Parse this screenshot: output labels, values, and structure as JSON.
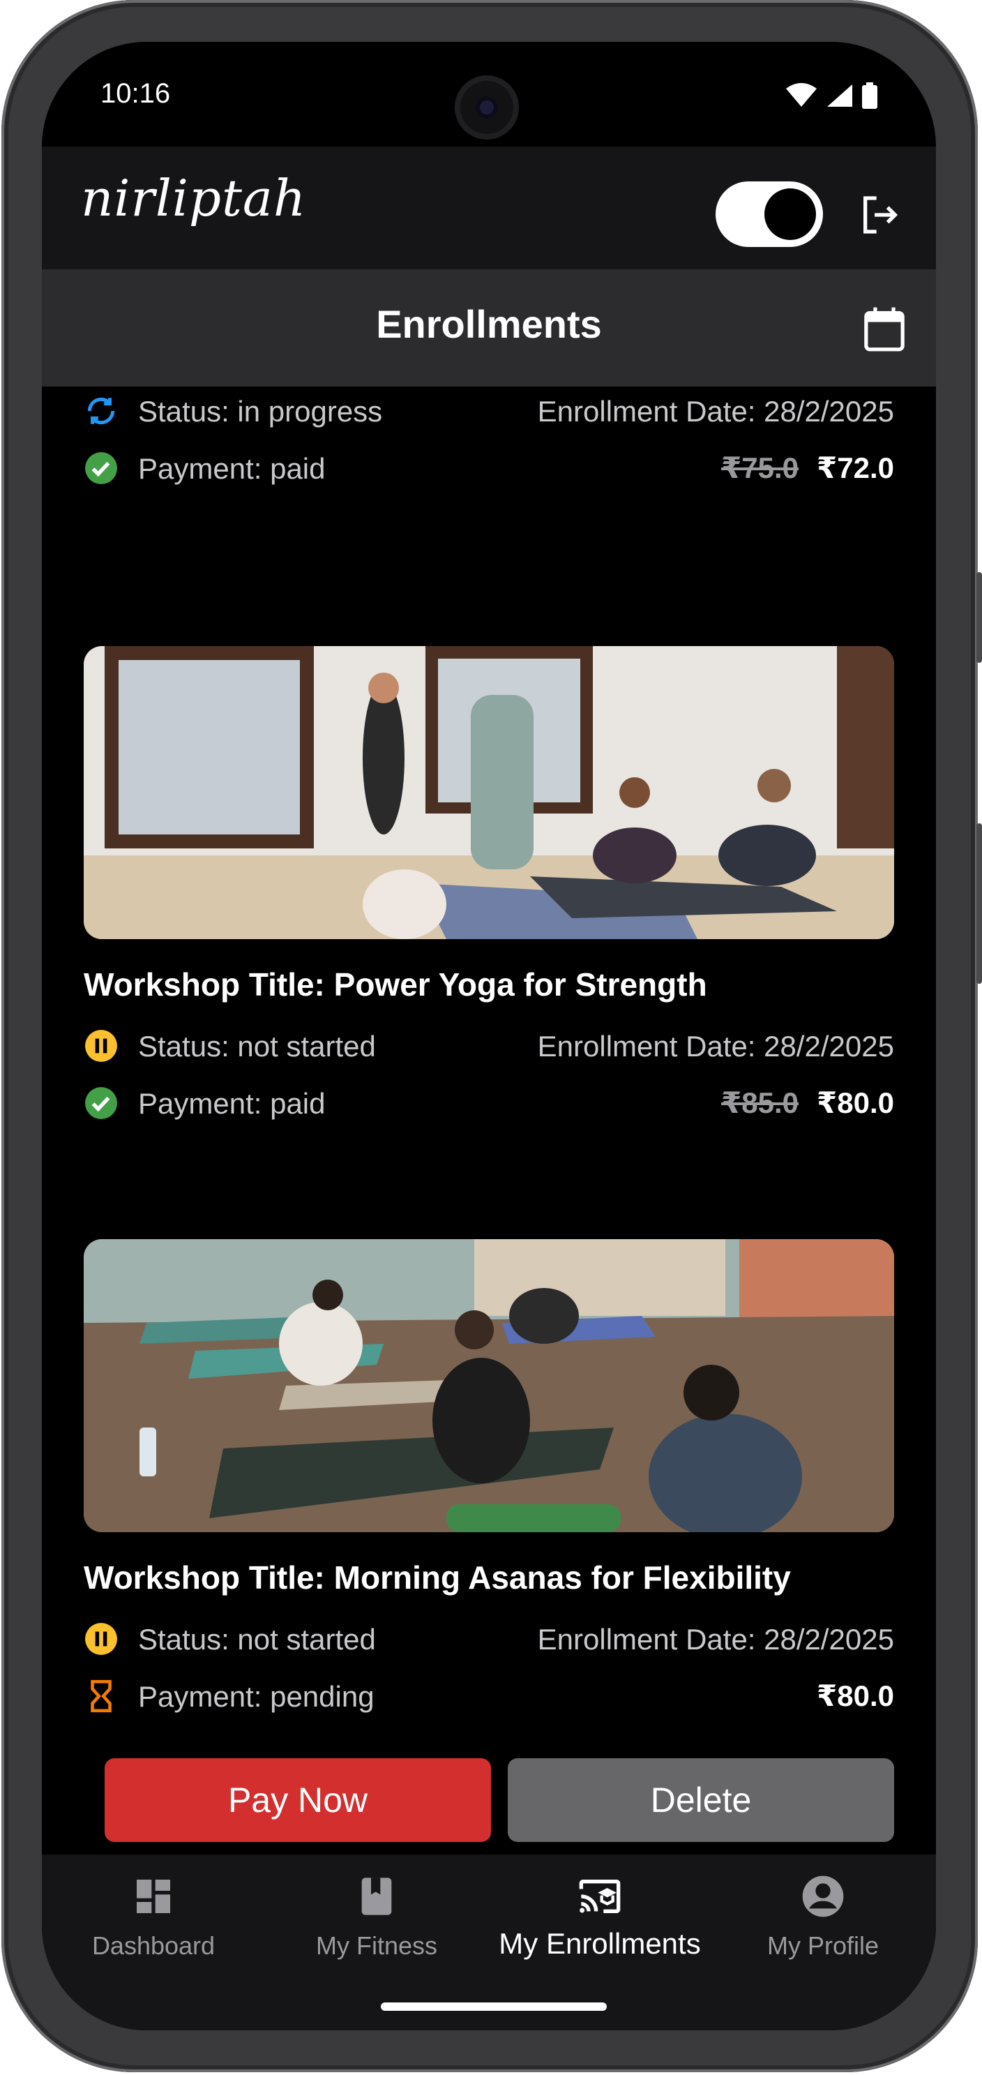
{
  "status_bar": {
    "time": "10:16"
  },
  "header": {
    "logo": "nirliptah"
  },
  "title_bar": {
    "title": "Enrollments"
  },
  "enrollments": [
    {
      "status": "Status: in progress",
      "enrollment_date": "Enrollment Date: 28/2/2025",
      "payment": "Payment: paid",
      "original_price": "₹75.0",
      "price": "₹72.0"
    },
    {
      "title": "Workshop Title: Power Yoga for Strength",
      "status": "Status: not started",
      "enrollment_date": "Enrollment Date: 28/2/2025",
      "payment": "Payment: paid",
      "original_price": "₹85.0",
      "price": "₹80.0"
    },
    {
      "title": "Workshop Title: Morning Asanas for Flexibility",
      "status": "Status: not started",
      "enrollment_date": "Enrollment Date: 28/2/2025",
      "payment": "Payment: pending",
      "price": "₹80.0",
      "pay_button": "Pay Now",
      "delete_button": "Delete"
    }
  ],
  "colors": {
    "in_progress": "#2196f3",
    "paid": "#43a047",
    "not_started": "#fbc02d",
    "pending": "#f57c00",
    "pay_button": "#d32f2f",
    "delete_button": "#676769"
  },
  "bottom_nav": {
    "items": [
      {
        "label": "Dashboard",
        "icon": "dashboard-icon"
      },
      {
        "label": "My Fitness",
        "icon": "book-icon"
      },
      {
        "label": "My Enrollments",
        "icon": "cast-school-icon",
        "active": true
      },
      {
        "label": "My Profile",
        "icon": "account-circle-icon"
      }
    ]
  }
}
